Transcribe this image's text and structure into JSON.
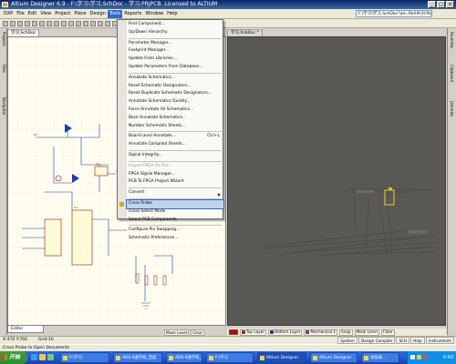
{
  "window": {
    "title": "Altium Designer 6.9 - F:\\学习\\学习.SchDoc - 学习.PRJPCB. Licensed to ALTIUM",
    "path": "F:\\学习\\学习.SchDoc?ad=Rel\\#ii(t!Ro"
  },
  "menu": {
    "items": [
      "DXP",
      "File",
      "Edit",
      "View",
      "Project",
      "Place",
      "Design",
      "Tools",
      "Reports",
      "Window",
      "Help"
    ]
  },
  "doc_tabs": {
    "schematic": "学习.SchDoc",
    "pcb": "学习.PcbDoc *"
  },
  "left_panels": [
    "Projects",
    "Files",
    "Navigator"
  ],
  "tools_menu": {
    "items": [
      {
        "label": "Find Component...",
        "shortcut": ""
      },
      {
        "label": "Up/Down Hierarchy",
        "shortcut": ""
      },
      {
        "sep": true
      },
      {
        "label": "Parameter Manager...",
        "shortcut": ""
      },
      {
        "label": "Footprint Manager...",
        "shortcut": ""
      },
      {
        "label": "Update From Libraries...",
        "shortcut": ""
      },
      {
        "label": "Update Parameters From Database...",
        "shortcut": ""
      },
      {
        "sep": true
      },
      {
        "label": "Annotate Schematics...",
        "shortcut": ""
      },
      {
        "label": "Reset Schematic Designators...",
        "shortcut": ""
      },
      {
        "label": "Reset Duplicate Schematic Designators...",
        "shortcut": ""
      },
      {
        "label": "Annotate Schematics Quietly...",
        "shortcut": ""
      },
      {
        "label": "Force Annotate All Schematics...",
        "shortcut": ""
      },
      {
        "label": "Back Annotate Schematics...",
        "shortcut": ""
      },
      {
        "label": "Number Schematic Sheets...",
        "shortcut": ""
      },
      {
        "sep": true
      },
      {
        "label": "Board Level Annotate...",
        "shortcut": "Ctrl+L"
      },
      {
        "label": "Annotate Compiled Sheets...",
        "shortcut": ""
      },
      {
        "sep": true
      },
      {
        "label": "Signal Integrity...",
        "shortcut": ""
      },
      {
        "sep": true
      },
      {
        "label": "Import FPGA Pin File",
        "shortcut": "",
        "disabled": true
      },
      {
        "label": "FPGA Signal Manager...",
        "shortcut": ""
      },
      {
        "label": "PCB To FPGA Project Wizard",
        "shortcut": ""
      },
      {
        "sep": true
      },
      {
        "label": "Convert",
        "shortcut": "",
        "submenu": true
      },
      {
        "sep": true
      },
      {
        "label": "Cross Probe",
        "shortcut": "",
        "highlighted": true
      },
      {
        "label": "Cross Select Mode",
        "shortcut": ""
      },
      {
        "label": "Select PCB Components",
        "shortcut": ""
      },
      {
        "sep": true
      },
      {
        "label": "Configure Pin Swapping...",
        "shortcut": ""
      },
      {
        "label": "Schematic Preferences...",
        "shortcut": ""
      }
    ]
  },
  "bottom": {
    "editor_tab": "Editor",
    "mask_buttons": [
      "Mask Level",
      "Clear"
    ],
    "layers": [
      {
        "name": "Top Layer",
        "color": "#cc0000"
      },
      {
        "name": "Bottom Layer",
        "color": "#0000cc"
      },
      {
        "name": "Mechanical 1",
        "color": "#c000c0"
      }
    ],
    "snap_buttons": [
      "Snap",
      "Mask Level",
      "Clear"
    ]
  },
  "status": {
    "coords": "X:470 Y:760",
    "grid": "Grid:10",
    "right_tabs": [
      "System",
      "Design Compiler",
      "SCH",
      "Help",
      "Instruments"
    ]
  },
  "hint": "Cross Probe to Open Documents",
  "taskbar": {
    "start": "开始",
    "tasks": [
      {
        "label": "F:\\学习",
        "active": false
      },
      {
        "label": "AD6.9通学校_百度",
        "active": false
      },
      {
        "label": "AD6.9通学校_百度",
        "active": false
      },
      {
        "label": "F:\\学习",
        "active": false
      },
      {
        "label": "Altium Designer",
        "active": true
      },
      {
        "label": "Altium Designer",
        "active": false
      },
      {
        "label": "添加表...",
        "active": false
      }
    ],
    "clock": "0:50"
  }
}
